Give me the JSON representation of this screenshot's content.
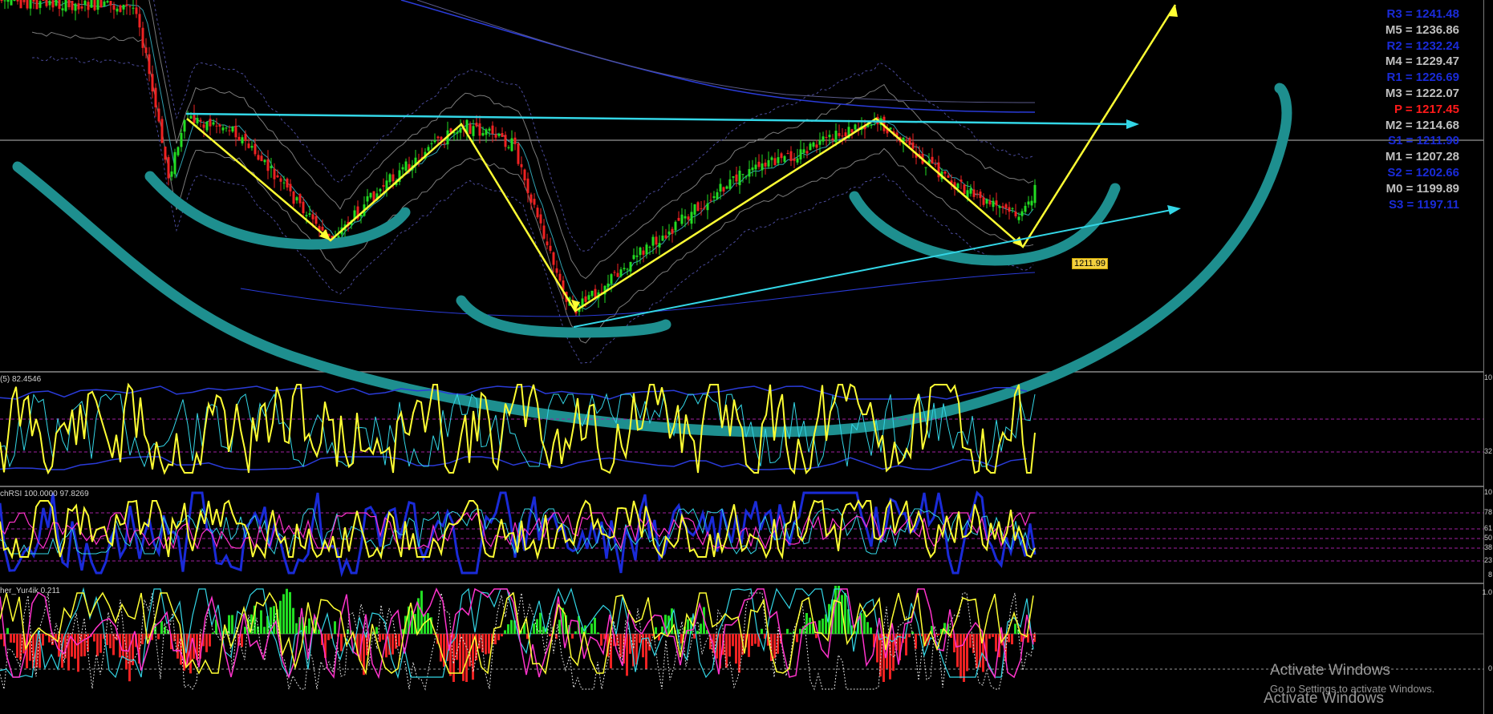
{
  "pivots": [
    {
      "label": "R3",
      "value": "1241.48",
      "color": "#1a2bd8"
    },
    {
      "label": "M5",
      "value": "1236.86",
      "color": "#bfbfbf"
    },
    {
      "label": "R2",
      "value": "1232.24",
      "color": "#1a2bd8"
    },
    {
      "label": "M4",
      "value": "1229.47",
      "color": "#bfbfbf"
    },
    {
      "label": "R1",
      "value": "1226.69",
      "color": "#1a2bd8"
    },
    {
      "label": "M3",
      "value": "1222.07",
      "color": "#bfbfbf"
    },
    {
      "label": "P",
      "value": "1217.45",
      "color": "#ff1a1a"
    },
    {
      "label": "M2",
      "value": "1214.68",
      "color": "#bfbfbf"
    },
    {
      "label": "S1",
      "value": "1211.90",
      "color": "#1a2bd8"
    },
    {
      "label": "M1",
      "value": "1207.28",
      "color": "#bfbfbf"
    },
    {
      "label": "S2",
      "value": "1202.66",
      "color": "#1a2bd8"
    },
    {
      "label": "M0",
      "value": "1199.89",
      "color": "#bfbfbf"
    },
    {
      "label": "S3",
      "value": "1197.11",
      "color": "#1a2bd8"
    }
  ],
  "price_label": "1211.99",
  "indicators": {
    "rsi_label": "(5) 82.4546",
    "stochrsi_label": "chRSI 100.0000 97.8269",
    "yur4ik_label": "her_Yur4ik 0.211"
  },
  "axis": {
    "rsi_top": "10",
    "rsi_mid": "32",
    "stoch_top": "10",
    "stoch_78": "78",
    "stoch_61": "61",
    "stoch_50": "50",
    "stoch_38": "38",
    "stoch_23": "23",
    "stoch_8": "8",
    "osc_top": "1.0",
    "osc_zero": "0"
  },
  "watermark": {
    "title": "Activate Windows",
    "subtitle": "Go to Settings to activate Windows.",
    "title_repeat": "Activate Windows"
  },
  "colors": {
    "background": "#000000",
    "zigzag": "#ffff33",
    "trendline": "#33d6e6",
    "cup_arc": "#1e8f8f",
    "bull_candle": "#22dd22",
    "bear_candle": "#ee2222"
  }
}
